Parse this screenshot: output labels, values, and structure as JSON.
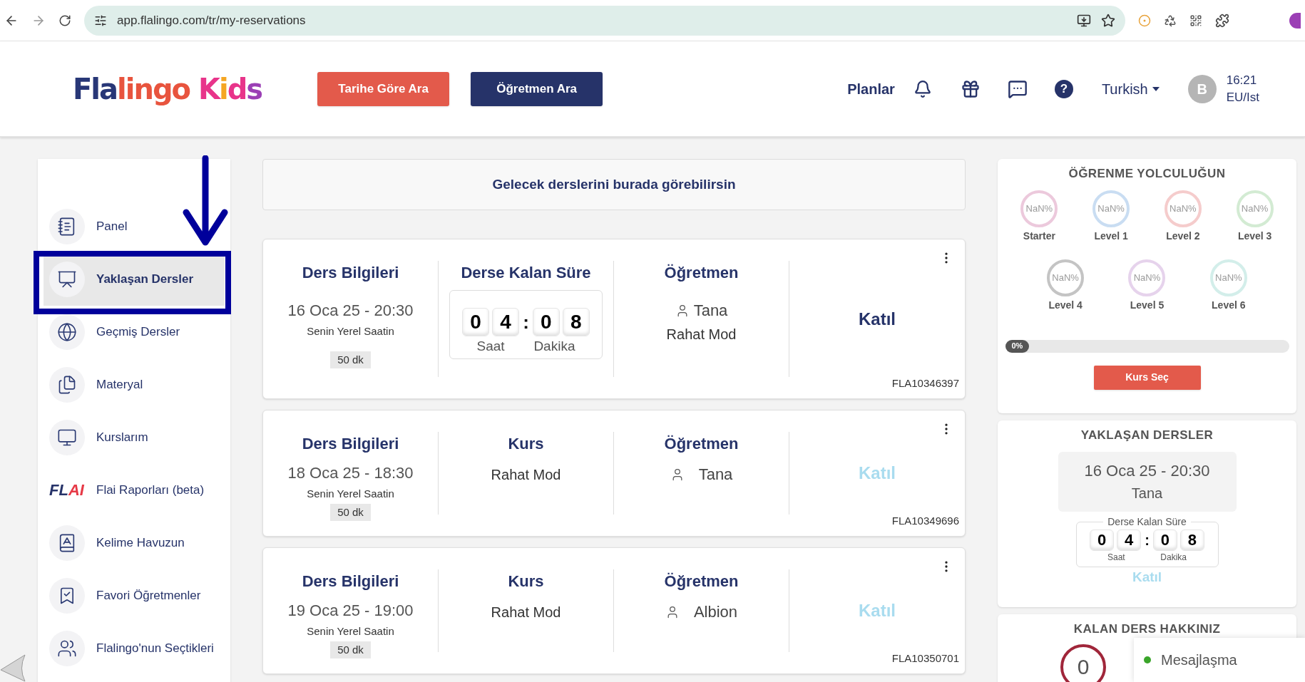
{
  "browser": {
    "url": "app.flalingo.com/tr/my-reservations"
  },
  "header": {
    "logo": [
      {
        "text": "Fla",
        "color": "#283777"
      },
      {
        "text": "lingo",
        "color": "#e8543e"
      },
      {
        "text": " K",
        "color": "#e8348a"
      },
      {
        "text": "i",
        "color": "#f5a623"
      },
      {
        "text": "d",
        "color": "#e8348a"
      },
      {
        "text": "s",
        "color": "#9b3fb5"
      }
    ],
    "buttons": [
      {
        "label": "Tarihe Göre Ara",
        "kind": "primary"
      },
      {
        "label": "Öğretmen Ara",
        "kind": "secondary"
      }
    ],
    "plans": "Planlar",
    "help": "?",
    "language": "Turkish",
    "avatar": "B",
    "time": "16:21",
    "timezone": "EU/Ist"
  },
  "sidebar": {
    "items": [
      {
        "label": "Panel",
        "selected": false
      },
      {
        "label": "Yaklaşan Dersler",
        "selected": true
      },
      {
        "label": "Geçmiş Dersler",
        "selected": false
      },
      {
        "label": "Materyal",
        "selected": false
      },
      {
        "label": "Kurslarım",
        "selected": false
      },
      {
        "label": "Flai Raporları (beta)",
        "logo_text": [
          "FL",
          "AI"
        ],
        "selected": false
      },
      {
        "label": "Kelime Havuzun",
        "selected": false
      },
      {
        "label": "Favori Öğretmenler",
        "selected": false
      },
      {
        "label": "Flalingo'nun Seçtikleri",
        "selected": false
      }
    ]
  },
  "banner": "Gelecek derslerini burada görebilirsin",
  "lessons": [
    {
      "info_title": "Ders Bilgileri",
      "date": "16 Oca 25 - 20:30",
      "local": "Senin Yerel Saatin",
      "duration": "50 dk",
      "middle": {
        "kind": "countdown",
        "title": "Derse Kalan Süre",
        "digits": [
          "0",
          "4",
          "0",
          "8"
        ],
        "separator": ":",
        "labels": [
          "Saat",
          "Dakika"
        ]
      },
      "teacher_title": "Öğretmen",
      "teacher": "Tana",
      "mode": "Rahat Mod",
      "join": "Katıl",
      "join_enabled": true,
      "code": "FLA10346397"
    },
    {
      "info_title": "Ders Bilgileri",
      "date": "18 Oca 25 - 18:30",
      "local": "Senin Yerel Saatin",
      "duration": "50 dk",
      "middle": {
        "kind": "course",
        "title": "Kurs",
        "course": "Rahat Mod"
      },
      "teacher_title": "Öğretmen",
      "teacher": "Tana",
      "join": "Katıl",
      "join_enabled": false,
      "code": "FLA10349696"
    },
    {
      "info_title": "Ders Bilgileri",
      "date": "19 Oca 25 - 19:00",
      "local": "Senin Yerel Saatin",
      "duration": "50 dk",
      "middle": {
        "kind": "course",
        "title": "Kurs",
        "course": "Rahat Mod"
      },
      "teacher_title": "Öğretmen",
      "teacher": "Albion",
      "join": "Katıl",
      "join_enabled": false,
      "code": "FLA10350701"
    }
  ],
  "journey": {
    "title": "ÖĞRENME YOLCULUĞUN",
    "levels": [
      {
        "name": "Starter",
        "value": "NaN%",
        "color": "#ecc9dc"
      },
      {
        "name": "Level 1",
        "value": "NaN%",
        "color": "#c9ddf2"
      },
      {
        "name": "Level 2",
        "value": "NaN%",
        "color": "#f5cccc"
      },
      {
        "name": "Level 3",
        "value": "NaN%",
        "color": "#d3ebd3"
      },
      {
        "name": "Level 4",
        "value": "NaN%",
        "color": "#c4c4c4"
      },
      {
        "name": "Level 5",
        "value": "NaN%",
        "color": "#e6d3ec"
      },
      {
        "name": "Level 6",
        "value": "NaN%",
        "color": "#d3eeea"
      }
    ],
    "progress": {
      "level": 0,
      "label": "0%"
    },
    "button": "Kurs Seç"
  },
  "upcoming": {
    "title": "YAKLAŞAN DERSLER",
    "date": "16 Oca 25 - 20:30",
    "teacher": "Tana",
    "legend": "Derse Kalan Süre",
    "digits": [
      "0",
      "4",
      "0",
      "8"
    ],
    "separator": ":",
    "labels": [
      "Saat",
      "Dakika"
    ],
    "join": "Katıl",
    "join_enabled": false
  },
  "remaining": {
    "title": "KALAN DERS HAKKINIZ",
    "count": "0"
  },
  "chat_popup": {
    "label": "Mesajlaşma",
    "online": true
  }
}
